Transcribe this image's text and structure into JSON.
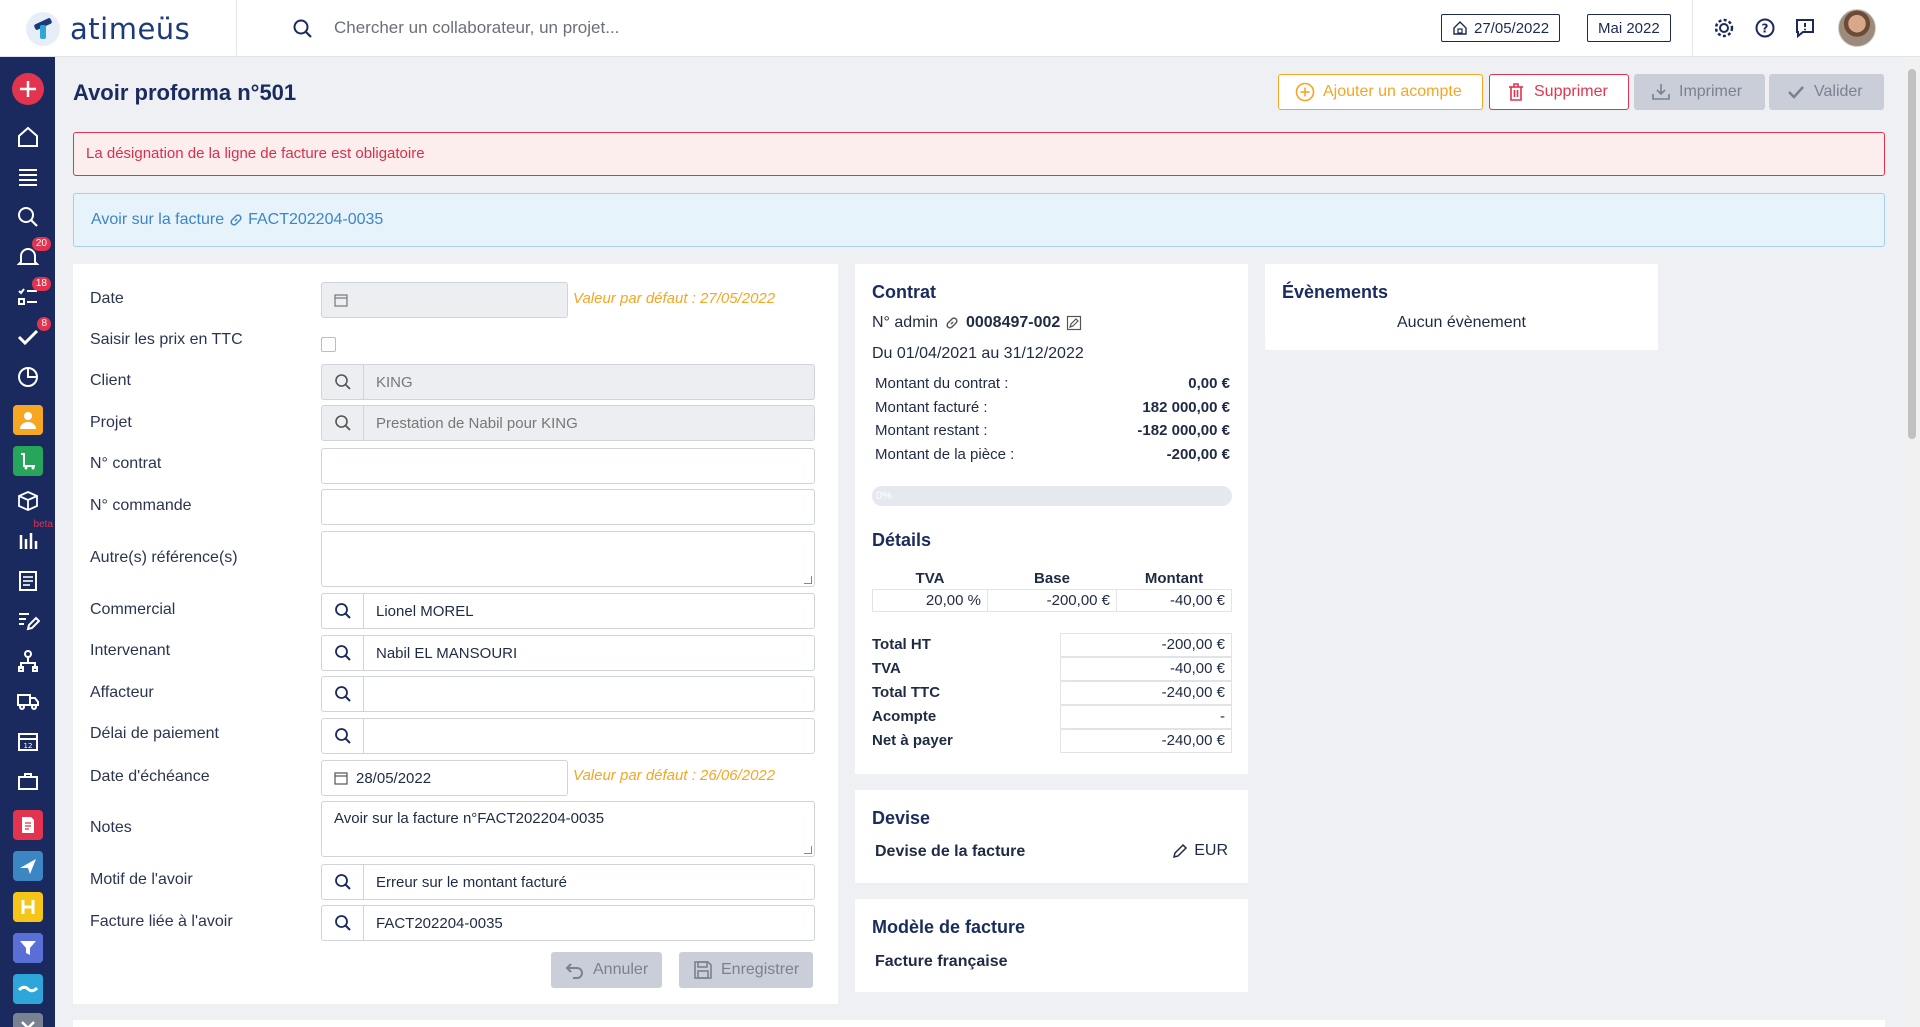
{
  "app": {
    "logo_text": "atimeüs"
  },
  "topbar": {
    "search_placeholder": "Chercher un collaborateur, un projet...",
    "date_label": "27/05/2022",
    "period_label": "Mai 2022"
  },
  "sidebar": {
    "badges": {
      "notifications": "20",
      "tasks": "18",
      "validations": "8",
      "beta": "beta"
    },
    "colors": {
      "bg": "#1b2a5e",
      "add": "#e2344f",
      "orange": "#f5a623",
      "green": "#27a55a",
      "red": "#e2344f",
      "blue": "#3d86c4",
      "yellow": "#f5c518",
      "purple": "#5a6fd6",
      "teal": "#2fa6d9"
    }
  },
  "page": {
    "title": "Avoir proforma n°501",
    "actions": {
      "acompte": "Ajouter un acompte",
      "supprimer": "Supprimer",
      "imprimer": "Imprimer",
      "valider": "Valider"
    },
    "error": "La désignation de la ligne de facture est obligatoire",
    "info_prefix": "Avoir sur la facture",
    "info_link": "FACT202204-0035"
  },
  "form": {
    "date_label": "Date",
    "date_default": "Valeur par défaut : 27/05/2022",
    "ttc_label": "Saisir les prix en TTC",
    "client_label": "Client",
    "client_value": "KING",
    "projet_label": "Projet",
    "projet_value": "Prestation de Nabil pour KING",
    "contrat_label": "N° contrat",
    "commande_label": "N° commande",
    "autres_label": "Autre(s) référence(s)",
    "commercial_label": "Commercial",
    "commercial_value": "Lionel MOREL",
    "intervenant_label": "Intervenant",
    "intervenant_value": "Nabil EL MANSOURI",
    "affacteur_label": "Affacteur",
    "delai_label": "Délai de paiement",
    "echeance_label": "Date d'échéance",
    "echeance_value": "28/05/2022",
    "echeance_default": "Valeur par défaut : 26/06/2022",
    "notes_label": "Notes",
    "notes_value": "Avoir sur la facture n°FACT202204-0035",
    "motif_label": "Motif de l'avoir",
    "motif_value": "Erreur sur le montant facturé",
    "facture_label": "Facture liée à l'avoir",
    "facture_value": "FACT202204-0035",
    "annuler": "Annuler",
    "enregistrer": "Enregistrer"
  },
  "contrat": {
    "title": "Contrat",
    "admin_label": "N° admin",
    "admin_value": "0008497-002",
    "period": "Du 01/04/2021 au 31/12/2022",
    "rows": [
      {
        "label": "Montant du contrat :",
        "value": "0,00 €"
      },
      {
        "label": "Montant facturé :",
        "value": "182 000,00 €"
      },
      {
        "label": "Montant restant :",
        "value": "-182 000,00 €"
      },
      {
        "label": "Montant de la pièce :",
        "value": "-200,00 €"
      }
    ],
    "progress_label": "0%",
    "progress_value": 0
  },
  "details": {
    "title": "Détails",
    "headers": [
      "TVA",
      "Base",
      "Montant"
    ],
    "row": [
      "20,00 %",
      "-200,00 €",
      "-40,00 €"
    ],
    "totals": [
      {
        "label": "Total HT",
        "value": "-200,00 €"
      },
      {
        "label": "TVA",
        "value": "-40,00 €"
      },
      {
        "label": "Total TTC",
        "value": "-240,00 €"
      },
      {
        "label": "Acompte",
        "value": "-"
      },
      {
        "label": "Net à payer",
        "value": "-240,00 €"
      }
    ]
  },
  "devise": {
    "title": "Devise",
    "label": "Devise de la facture",
    "value": "EUR"
  },
  "modele": {
    "title": "Modèle de facture",
    "value": "Facture française"
  },
  "evenements": {
    "title": "Évènements",
    "empty": "Aucun évènement"
  }
}
